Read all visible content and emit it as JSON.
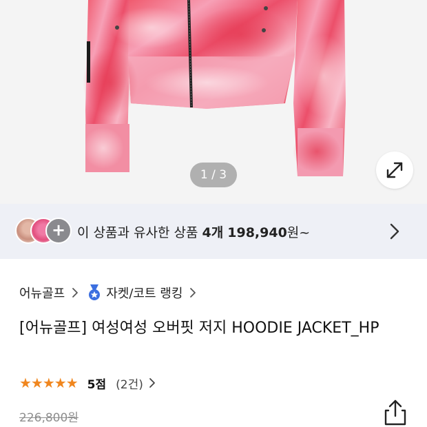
{
  "gallery": {
    "counter": "1 / 3",
    "expand_icon": "expand-icon"
  },
  "similar": {
    "prefix": "이 상품과 유사한 상품",
    "count": "4개",
    "price": "198,940",
    "suffix": "원~",
    "plus_label": "+"
  },
  "breadcrumb": {
    "brand": "어뉴골프",
    "category": "자켓/코트 랭킹"
  },
  "product": {
    "title": "[어뉴골프] 여성여성 오버핏 저지 HOODIE JACKET_HP",
    "stars": "★★★★★",
    "score": "5점",
    "reviews": "(2건)",
    "original_price": "226,800원"
  },
  "colors": {
    "accent_star": "#f0861e",
    "strip_bg": "#eef0f6"
  }
}
